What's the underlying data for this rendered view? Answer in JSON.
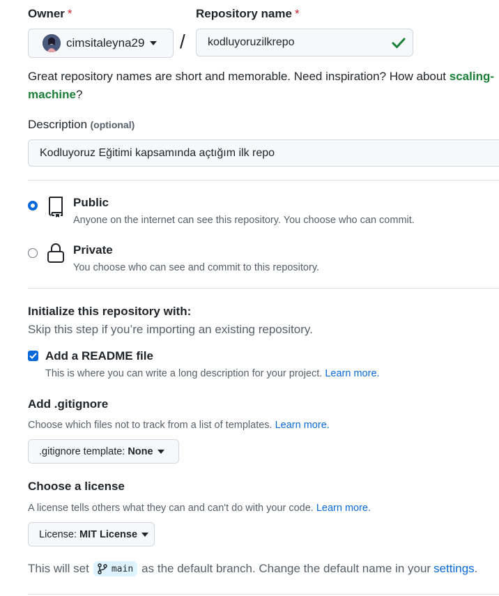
{
  "owner": {
    "label": "Owner",
    "required_mark": "*",
    "value": "cimsitaleyna29"
  },
  "separator": "/",
  "repo_name": {
    "label": "Repository name",
    "required_mark": "*",
    "value": "kodluyoruzilkrepo"
  },
  "name_hint": {
    "text": "Great repository names are short and memorable. Need inspiration? How about ",
    "suggestion_part1": "scaling-",
    "suggestion_part2": "machine",
    "suffix": "?"
  },
  "description": {
    "label": "Description",
    "optional": "(optional)",
    "value": "Kodluyoruz Eğitimi kapsamında açtığım ilk repo"
  },
  "visibility": {
    "public": {
      "title": "Public",
      "desc": "Anyone on the internet can see this repository. You choose who can commit.",
      "selected": true
    },
    "private": {
      "title": "Private",
      "desc": "You choose who can see and commit to this repository.",
      "selected": false
    }
  },
  "init": {
    "heading": "Initialize this repository with:",
    "subheading": "Skip this step if you’re importing an existing repository.",
    "readme": {
      "label": "Add a README file",
      "desc": "This is where you can write a long description for your project.",
      "link": "Learn more.",
      "checked": true
    }
  },
  "gitignore": {
    "heading": "Add .gitignore",
    "desc": "Choose which files not to track from a list of templates.",
    "link": "Learn more.",
    "button_prefix": ".gitignore template:",
    "button_value": "None"
  },
  "license": {
    "heading": "Choose a license",
    "desc": "A license tells others what they can and can't do with your code.",
    "link": "Learn more.",
    "button_prefix": "License:",
    "button_value": "MIT License"
  },
  "branch_note": {
    "prefix": "This will set",
    "branch": "main",
    "suffix": "as the default branch. Change the default name in your",
    "link": "settings",
    "end": "."
  },
  "colors": {
    "accent": "#0969da",
    "success": "#1a7f37",
    "danger": "#cf222e",
    "code_bg": "#ddf4ff"
  }
}
